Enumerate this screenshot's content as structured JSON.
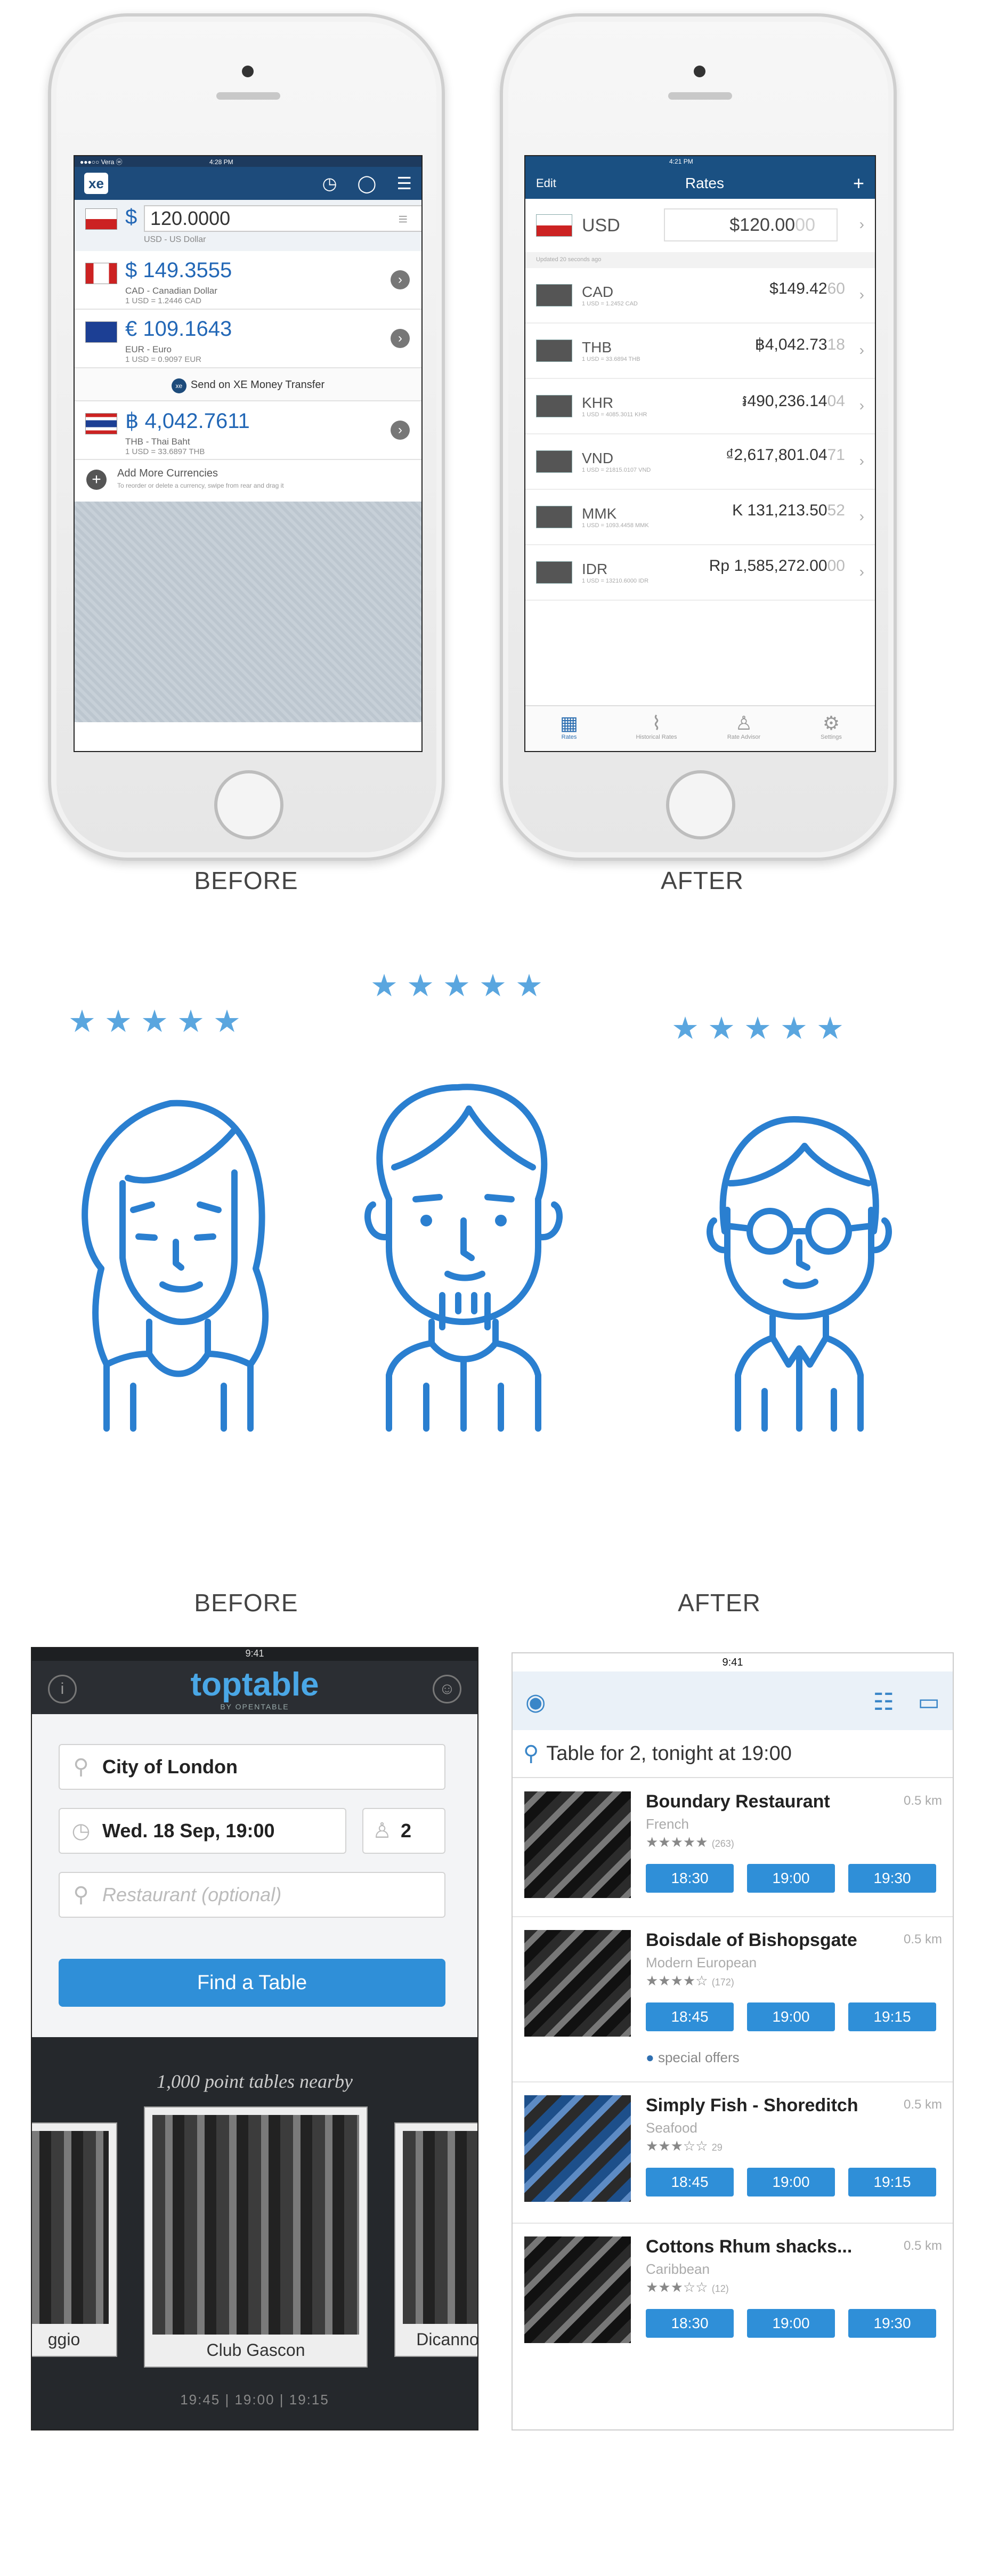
{
  "captions": {
    "xe_before": "BEFORE",
    "xe_after": "AFTER",
    "tt_before": "BEFORE",
    "tt_after": "AFTER"
  },
  "xe_before": {
    "status_left": "●●●○○ Vera ⓦ",
    "status_center": "4:28 PM",
    "base_input": "120.0000",
    "base_symbol": "$",
    "base_sub": "USD - US Dollar",
    "rows": [
      {
        "amount": "$ 149.3555",
        "name": "CAD - Canadian Dollar",
        "rate": "1 USD = 1.2446 CAD"
      },
      {
        "amount": "€ 109.1643",
        "name": "EUR - Euro",
        "rate": "1 USD = 0.9097 EUR"
      },
      {
        "amount": "฿ 4,042.7611",
        "name": "THB - Thai Baht",
        "rate": "1 USD = 33.6897 THB"
      }
    ],
    "send_label": "Send on XE Money Transfer",
    "add_title": "Add More Currencies",
    "add_sub": "To reorder or delete a currency, swipe from rear and drag it"
  },
  "xe_after": {
    "status_center": "4:21 PM",
    "nav_left": "Edit",
    "nav_title": "Rates",
    "nav_right": "+",
    "base_code": "USD",
    "base_value": "$120.00",
    "base_dim": "00",
    "updated": "Updated 20 seconds ago",
    "rows": [
      {
        "code": "CAD",
        "value": "$149.42",
        "dim": "60",
        "sub": "1 USD = 1.2452 CAD"
      },
      {
        "code": "THB",
        "value": "฿4,042.73",
        "dim": "18",
        "sub": "1 USD = 33.6894 THB"
      },
      {
        "code": "KHR",
        "value": "៛490,236.14",
        "dim": "04",
        "sub": "1 USD = 4085.3011 KHR"
      },
      {
        "code": "VND",
        "value": "₫2,617,801.04",
        "dim": "71",
        "sub": "1 USD = 21815.0107 VND"
      },
      {
        "code": "MMK",
        "value": "K 131,213.50",
        "dim": "52",
        "sub": "1 USD = 1093.4458 MMK"
      },
      {
        "code": "IDR",
        "value": "Rp 1,585,272.00",
        "dim": "00",
        "sub": "1 USD = 13210.6000 IDR"
      }
    ],
    "tabs": [
      "Rates",
      "Historical Rates",
      "Rate Advisor",
      "Settings"
    ]
  },
  "avatars": {
    "star_count": 5,
    "icons": [
      "woman-avatar-icon",
      "bearded-man-avatar-icon",
      "man-with-glasses-avatar-icon"
    ],
    "accent": "#2a7fd0"
  },
  "tt_before": {
    "time": "9:41",
    "logo": "toptable",
    "logo_sub": "BY OPENTABLE",
    "location": "City of London",
    "date_time": "Wed. 18 Sep, 19:00",
    "party": "2",
    "restaurant_placeholder": "Restaurant (optional)",
    "find_button": "Find a Table",
    "tagline": "1,000 point tables nearby",
    "cards": [
      "ggio",
      "Club Gascon",
      "Dicanno"
    ],
    "times": "19:45 | 19:00 | 19:15"
  },
  "tt_after": {
    "time": "9:41",
    "search": "Table for 2, tonight at 19:00",
    "restaurants": [
      {
        "name": "Boundary Restaurant",
        "cuisine": "French",
        "stars": "★★★★★",
        "count": "(263)",
        "dist": "0.5 km",
        "slots": [
          "18:30",
          "19:00",
          "19:30"
        ],
        "offer": ""
      },
      {
        "name": "Boisdale of Bishopsgate",
        "cuisine": "Modern European",
        "stars": "★★★★☆",
        "count": "(172)",
        "dist": "0.5 km",
        "slots": [
          "18:45",
          "19:00",
          "19:15"
        ],
        "offer": "special offers"
      },
      {
        "name": "Simply Fish - Shoreditch",
        "cuisine": "Seafood",
        "stars": "★★★☆☆",
        "count": "29",
        "dist": "0.5 km",
        "slots": [
          "18:45",
          "19:00",
          "19:15"
        ],
        "offer": ""
      },
      {
        "name": "Cottons Rhum shacks...",
        "cuisine": "Caribbean",
        "stars": "★★★☆☆",
        "count": "(12)",
        "dist": "0.5 km",
        "slots": [
          "18:30",
          "19:00",
          "19:30"
        ],
        "offer": ""
      }
    ]
  }
}
